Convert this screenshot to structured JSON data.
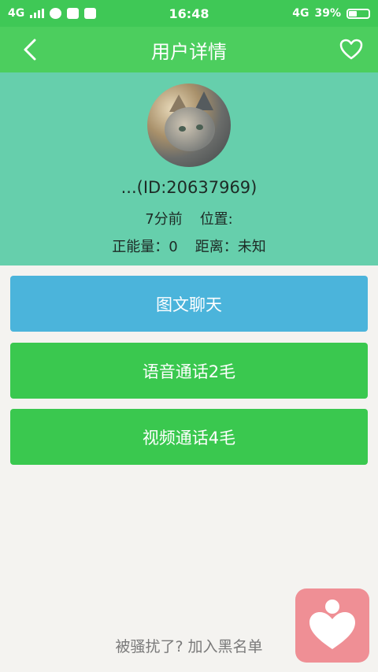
{
  "status_bar": {
    "network": "4G",
    "time": "16:48",
    "network_right": "4G",
    "battery_pct": "39%",
    "battery_level": 0.39
  },
  "header": {
    "title": "用户详情",
    "back_icon": "chevron-left-icon",
    "favorite_icon": "heart-outline-icon"
  },
  "profile": {
    "id_text": "...(ID:20637969)",
    "last_seen": "7分前",
    "location": "位置:",
    "energy": "正能量：0",
    "distance": "距离：未知"
  },
  "actions": {
    "chat": "图文聊天",
    "voice": "语音通话2毛",
    "video": "视频通话4毛"
  },
  "footer": {
    "blacklist": "被骚扰了? 加入黑名单"
  },
  "colors": {
    "status_bar": "#3fc856",
    "app_bar": "#4cce5e",
    "profile_bg": "#66cfac",
    "chat_button": "#4bb4db",
    "call_button": "#3ac84f",
    "floating_button": "#ef8f95"
  }
}
